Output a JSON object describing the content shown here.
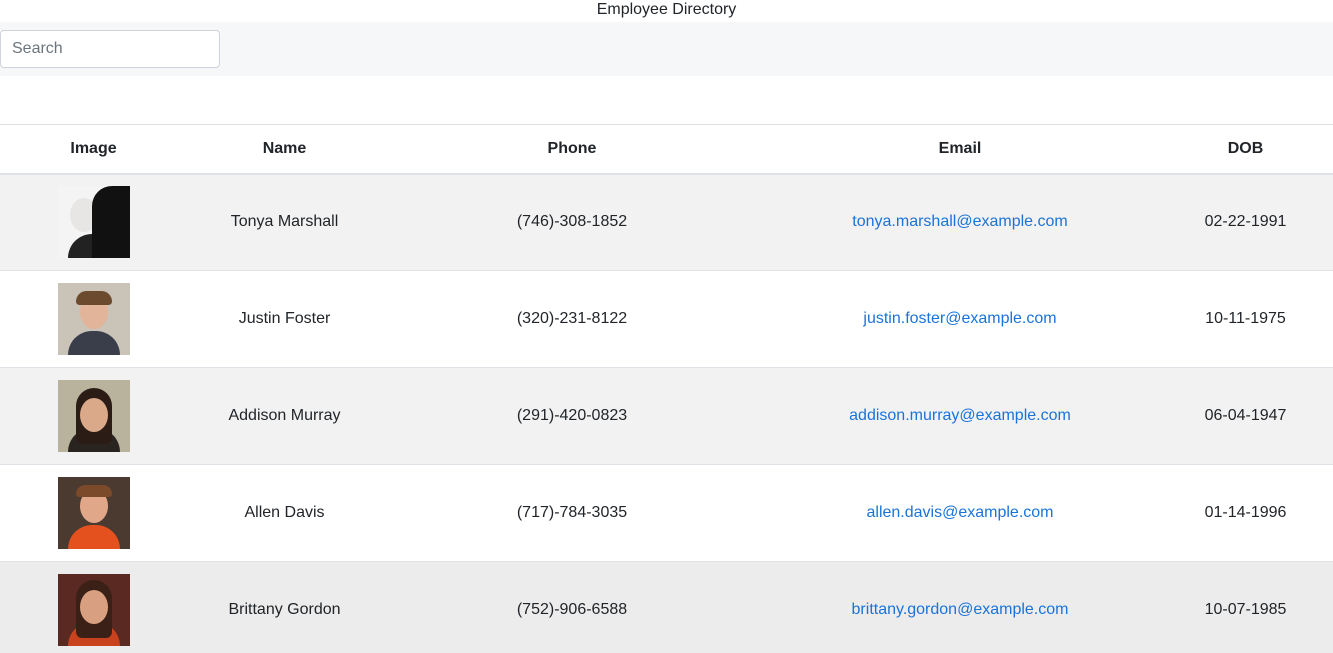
{
  "app": {
    "title": "Employee Directory"
  },
  "search": {
    "placeholder": "Search",
    "value": ""
  },
  "table": {
    "headers": {
      "image": "Image",
      "name": "Name",
      "phone": "Phone",
      "email": "Email",
      "dob": "DOB"
    },
    "rows": [
      {
        "name": "Tonya Marshall",
        "phone": "(746)-308-1852",
        "email": "tonya.marshall@example.com",
        "dob": "02-22-1991"
      },
      {
        "name": "Justin Foster",
        "phone": "(320)-231-8122",
        "email": "justin.foster@example.com",
        "dob": "10-11-1975"
      },
      {
        "name": "Addison Murray",
        "phone": "(291)-420-0823",
        "email": "addison.murray@example.com",
        "dob": "06-04-1947"
      },
      {
        "name": "Allen Davis",
        "phone": "(717)-784-3035",
        "email": "allen.davis@example.com",
        "dob": "01-14-1996"
      },
      {
        "name": "Brittany Gordon",
        "phone": "(752)-906-6588",
        "email": "brittany.gordon@example.com",
        "dob": "10-07-1985"
      }
    ]
  },
  "colors": {
    "link": "#1a73d9",
    "stripe": "#f2f2f2",
    "search_bar_bg": "#f6f7f8"
  }
}
